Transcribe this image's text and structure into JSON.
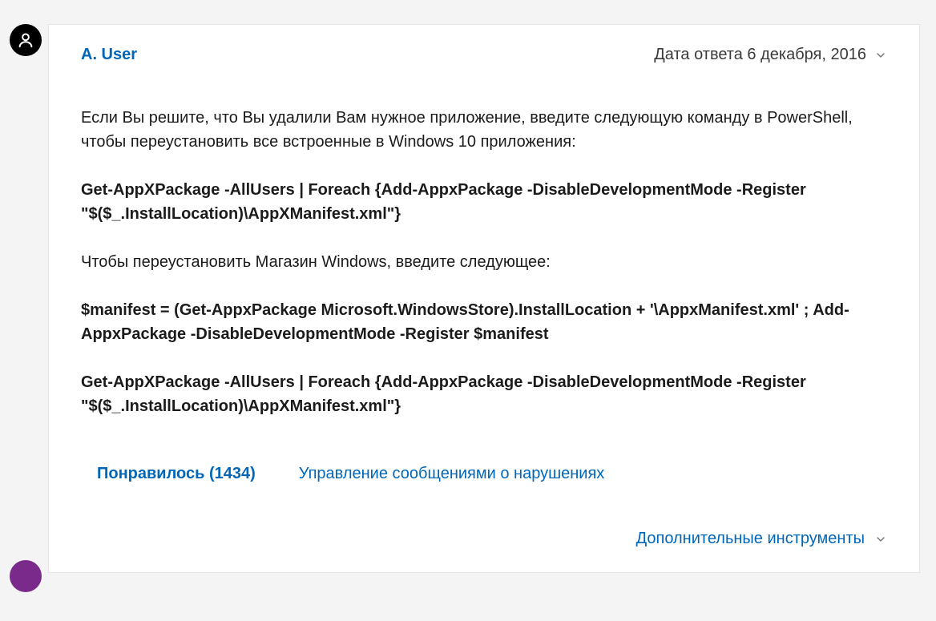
{
  "post": {
    "author": "A. User",
    "reply_date_label": "Дата ответа 6 декабря, 2016",
    "paragraphs": {
      "intro": "Если Вы решите, что Вы удалили Вам нужное приложение, введите следующую команду в PowerShell, чтобы переустановить все встроенные в Windows 10 приложения:",
      "cmd1": "Get-AppXPackage -AllUsers | Foreach {Add-AppxPackage -DisableDevelopmentMode -Register \"$($_.InstallLocation)\\AppXManifest.xml\"}",
      "store_intro": "Чтобы переустановить Магазин Windows, введите следующее:",
      "cmd2": "$manifest = (Get-AppxPackage Microsoft.WindowsStore).InstallLocation + '\\AppxManifest.xml' ; Add-AppxPackage -DisableDevelopmentMode -Register $manifest",
      "cmd3": "Get-AppXPackage -AllUsers | Foreach {Add-AppxPackage -DisableDevelopmentMode -Register \"$($_.InstallLocation)\\AppXManifest.xml\"}"
    },
    "actions": {
      "like_label": "Понравилось (1434)",
      "report_label": "Управление сообщениями о нарушениях"
    },
    "more_tools_label": "Дополнительные инструменты"
  }
}
